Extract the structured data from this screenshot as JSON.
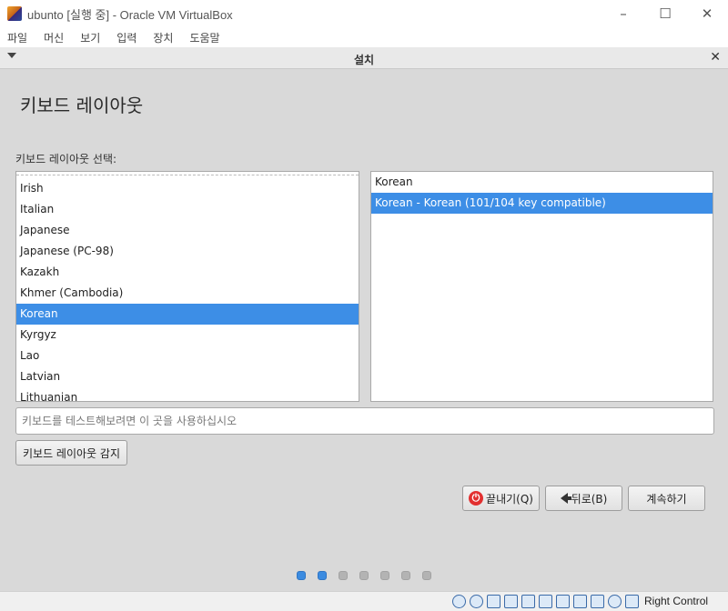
{
  "window": {
    "title": "ubunto [실행 중] - Oracle VM VirtualBox",
    "controls": {
      "minimize": "–",
      "maximize": "☐",
      "close": "✕"
    }
  },
  "menubar": {
    "items": [
      "파일",
      "머신",
      "보기",
      "입력",
      "장치",
      "도움말"
    ]
  },
  "installer": {
    "header_title": "설치",
    "close_glyph": "✕",
    "page_title": "키보드 레이아웃",
    "section_label": "키보드 레이아웃 선택:",
    "layouts": [
      "Irish",
      "Italian",
      "Japanese",
      "Japanese (PC-98)",
      "Kazakh",
      "Khmer (Cambodia)",
      "Korean",
      "Kyrgyz",
      "Lao",
      "Latvian",
      "Lithuanian"
    ],
    "selected_layout": "Korean",
    "variants": [
      "Korean",
      "Korean - Korean (101/104 key compatible)"
    ],
    "selected_variant": "Korean - Korean (101/104 key compatible)",
    "test_placeholder": "키보드를 테스트해보려면 이 곳을 사용하십시오",
    "detect_button": "키보드 레이아웃 감지",
    "quit_button": "끝내기(Q)",
    "back_button": "뒤로(B)",
    "continue_button": "계속하기",
    "progress_step": 2,
    "progress_total": 7
  },
  "statusbar": {
    "host_key": "Right Control",
    "icons": [
      "hard-disk-icon",
      "optical-drive-icon",
      "audio-icon",
      "network-icon",
      "usb-icon",
      "shared-folders-icon",
      "display-icon",
      "video-capture-icon",
      "recording-icon",
      "virtualization-icon",
      "mouse-integration-icon",
      "keyboard-capture-icon"
    ]
  },
  "colors": {
    "selection": "#3d8ee6",
    "dot_active": "#3b8be0",
    "dot_inactive": "#b3b3b3",
    "quit_icon": "#e23030"
  }
}
